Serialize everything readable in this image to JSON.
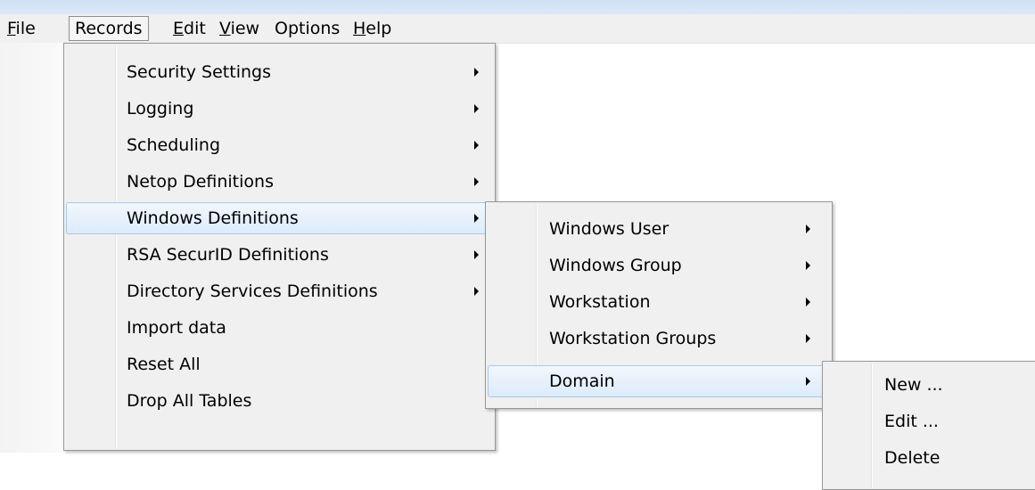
{
  "menubar": {
    "file": {
      "first": "F",
      "rest": "ile"
    },
    "records": "Records",
    "edit": {
      "first": "E",
      "rest": "dit"
    },
    "view": {
      "first": "V",
      "rest": "iew"
    },
    "options": "Options",
    "help": {
      "first": "H",
      "rest": "elp"
    }
  },
  "records_menu": {
    "items": [
      {
        "label": "Security Settings"
      },
      {
        "label": "Logging"
      },
      {
        "label": "Scheduling"
      },
      {
        "label": "Netop Definitions"
      },
      {
        "label": "Windows Definitions"
      },
      {
        "label": "RSA SecurID Definitions"
      },
      {
        "label": "Directory Services Definitions"
      },
      {
        "label": "Import data"
      },
      {
        "label": "Reset All"
      },
      {
        "label": "Drop All Tables"
      }
    ]
  },
  "windows_definitions_menu": {
    "items": [
      {
        "label": "Windows User"
      },
      {
        "label": "Windows Group"
      },
      {
        "label": "Workstation"
      },
      {
        "label": "Workstation Groups"
      },
      {
        "label": "Domain"
      }
    ]
  },
  "domain_menu": {
    "items": [
      {
        "label": "New ..."
      },
      {
        "label": "Edit ..."
      },
      {
        "label": "Delete"
      }
    ]
  }
}
